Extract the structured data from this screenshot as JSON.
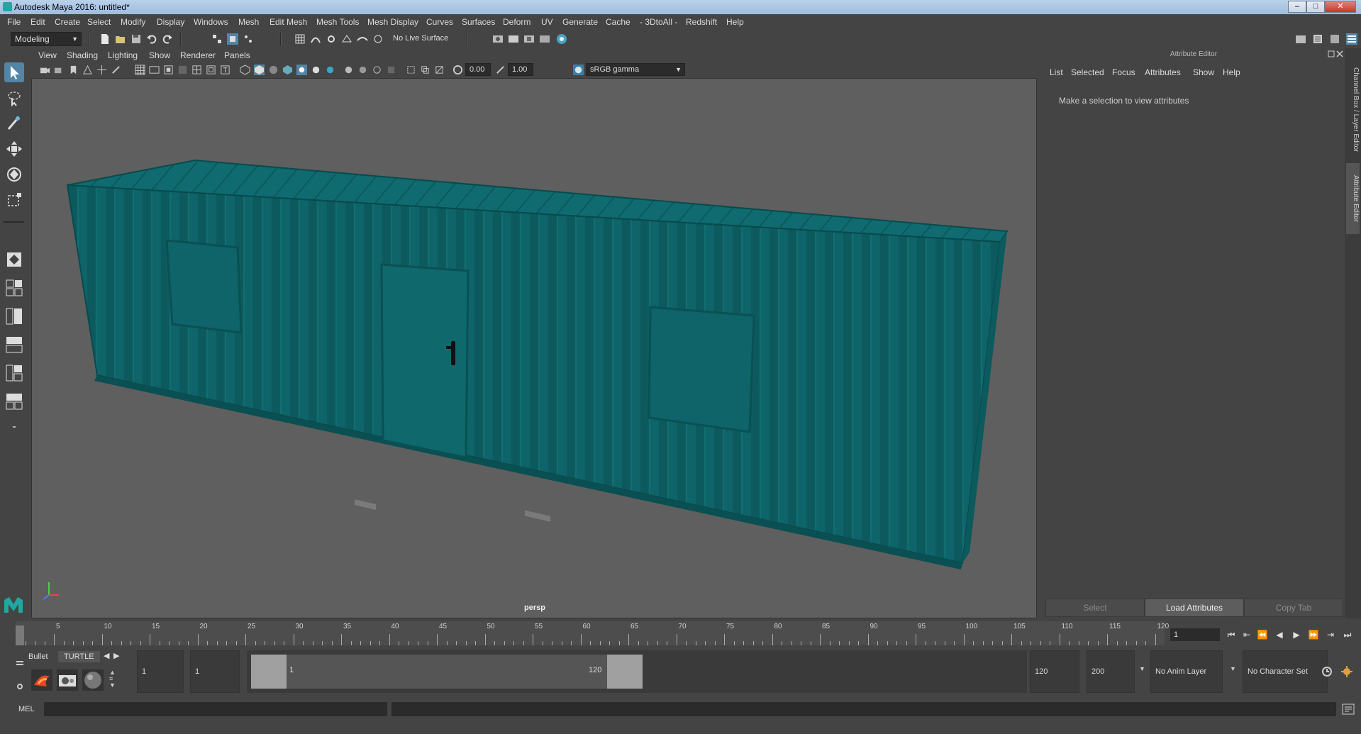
{
  "window": {
    "title": "Autodesk Maya 2016: untitled*",
    "min_glyph": "–",
    "max_glyph": "□",
    "close_glyph": "✕"
  },
  "menubar": [
    "File",
    "Edit",
    "Create",
    "Select",
    "Modify",
    "Display",
    "Windows",
    "Mesh",
    "Edit Mesh",
    "Mesh Tools",
    "Mesh Display",
    "Curves",
    "Surfaces",
    "Deform",
    "UV",
    "Generate",
    "Cache",
    "- 3DtoAll -",
    "Redshift",
    "Help"
  ],
  "statusline": {
    "mode": "Modeling",
    "live_surface": "No Live Surface"
  },
  "panel_menu": [
    "View",
    "Shading",
    "Lighting",
    "Show",
    "Renderer",
    "Panels"
  ],
  "panel_bar": {
    "exposure": "0.00",
    "gamma": "1.00",
    "color_space": "sRGB gamma"
  },
  "viewport": {
    "camera": "persp",
    "model_color": "#0e6468"
  },
  "attribute_editor": {
    "header": "Attribute Editor",
    "menu": [
      "List",
      "Selected",
      "Focus",
      "Attributes",
      "Show",
      "Help"
    ],
    "message": "Make a selection to view attributes",
    "buttons": {
      "select": "Select",
      "load": "Load Attributes",
      "copy": "Copy Tab"
    },
    "side_tabs": [
      "Channel Box / Layer Editor",
      "Attribute Editor"
    ]
  },
  "timeslider": {
    "ticks": [
      "1",
      "5",
      "10",
      "15",
      "20",
      "25",
      "30",
      "35",
      "40",
      "45",
      "50",
      "55",
      "60",
      "65",
      "70",
      "75",
      "80",
      "85",
      "90",
      "95",
      "100",
      "105",
      "110",
      "115",
      "120"
    ],
    "current_frame": "1"
  },
  "range": {
    "start": "1",
    "playback_start": "1",
    "range_start_label": "1",
    "range_end_label": "120",
    "playback_end": "120",
    "end": "200",
    "anim_layer": "No Anim Layer",
    "character_set": "No Character Set"
  },
  "shelf": {
    "tab_bullet": "Bullet",
    "tab_turtle": "TURTLE"
  },
  "cmdline": {
    "label": "MEL"
  }
}
